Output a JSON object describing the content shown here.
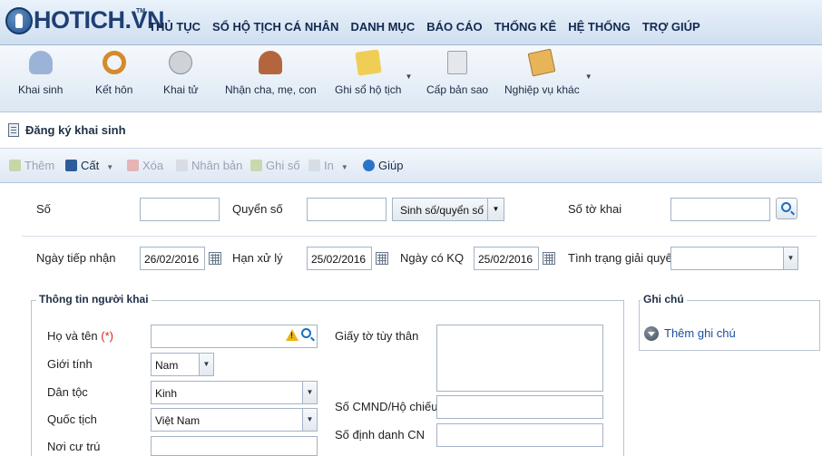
{
  "app": {
    "logo_text": "HOTICH.VN",
    "logo_tm": "TM"
  },
  "menu": [
    "THỦ TỤC",
    "SỔ HỘ TỊCH CÁ NHÂN",
    "DANH MỤC",
    "BÁO CÁO",
    "THỐNG KÊ",
    "HỆ THỐNG",
    "TRỢ GIÚP"
  ],
  "tools": [
    {
      "label": "Khai sinh",
      "icon": "baby-icon",
      "color": "#9bb3d6"
    },
    {
      "label": "Kết hôn",
      "icon": "rings-icon",
      "color": "#d58a2b"
    },
    {
      "label": "Khai tử",
      "icon": "ghost-face-icon",
      "color": "#cfd3d8"
    },
    {
      "label": "Nhận cha, mẹ, con",
      "icon": "family-icon",
      "color": "#b5653e"
    },
    {
      "label": "Ghi sổ hộ tịch",
      "icon": "notebook-pen-icon",
      "color": "#f0cd55",
      "has_dropdown": true
    },
    {
      "label": "Cấp bản sao",
      "icon": "copy-document-icon",
      "color": "#e4e7eb"
    },
    {
      "label": "Nghiệp vụ khác",
      "icon": "certificate-icon",
      "color": "#e8b45a",
      "has_dropdown": true
    }
  ],
  "page_title": "Đăng ký khai sinh",
  "actions": {
    "them": "Thêm",
    "cat": "Cất",
    "xoa": "Xóa",
    "nhan_ban": "Nhân bản",
    "ghi_so": "Ghi số",
    "in": "In",
    "giup": "Giúp"
  },
  "form": {
    "so_label": "Số",
    "so_value": "",
    "quyen_so_label": "Quyển số",
    "quyen_so_value": "",
    "sinh_so_button": "Sinh số/quyển số",
    "so_to_khai_label": "Số tờ khai",
    "so_to_khai_value": "",
    "ngay_tiep_nhan_label": "Ngày tiếp nhận",
    "ngay_tiep_nhan_value": "26/02/2016",
    "han_xu_ly_label": "Hạn xử lý",
    "han_xu_ly_value": "25/02/2016",
    "ngay_co_kq_label": "Ngày có KQ",
    "ngay_co_kq_value": "25/02/2016",
    "tinh_trang_label": "Tình trạng giải quyết",
    "tinh_trang_value": ""
  },
  "nguoi_khai": {
    "legend": "Thông tin người khai",
    "ho_ten_label": "Họ và tên",
    "required_mark": "(*)",
    "ho_ten_value": "",
    "gioi_tinh_label": "Giới tính",
    "gioi_tinh_value": "Nam",
    "dan_toc_label": "Dân tộc",
    "dan_toc_value": "Kinh",
    "quoc_tich_label": "Quốc tịch",
    "quoc_tich_value": "Việt Nam",
    "noi_cu_tru_label": "Nơi cư trú",
    "giay_to_label": "Giấy tờ tùy thân",
    "cmnd_label": "Số CMND/Hộ chiếu",
    "dinh_danh_label": "Số định danh CN"
  },
  "ghi_chu": {
    "legend": "Ghi chú",
    "add_label": "Thêm ghi chú"
  }
}
